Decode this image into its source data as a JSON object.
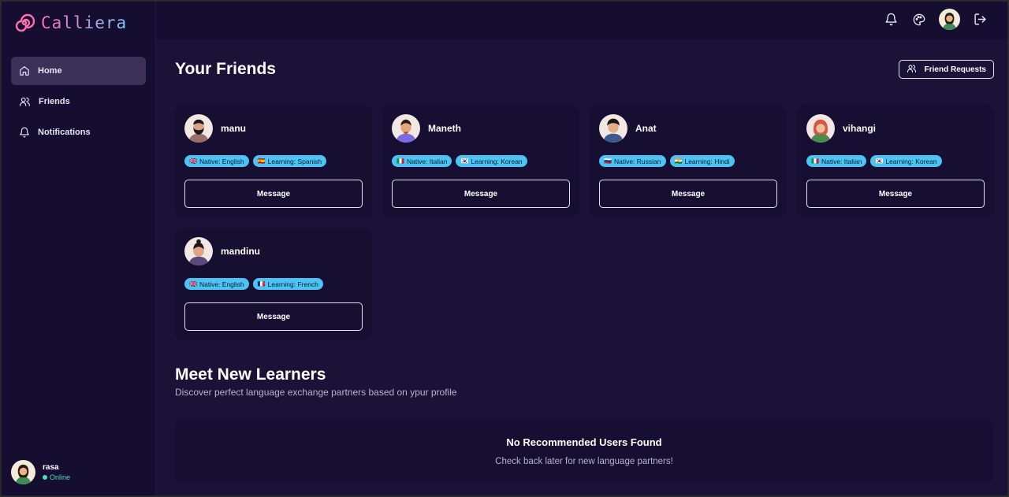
{
  "app": {
    "name": "Calliera"
  },
  "sidebar": {
    "items": [
      {
        "label": "Home",
        "icon": "home-icon",
        "active": true
      },
      {
        "label": "Friends",
        "icon": "users-icon",
        "active": false
      },
      {
        "label": "Notifications",
        "icon": "bell-icon",
        "active": false
      }
    ],
    "user": {
      "name": "rasa",
      "status": "Online"
    }
  },
  "header": {
    "icons": [
      "bell-icon",
      "palette-icon",
      "avatar",
      "logout-icon"
    ]
  },
  "friends_section": {
    "title": "Your Friends",
    "requests_label": "Friend Requests",
    "message_label": "Message",
    "friends": [
      {
        "name": "manu",
        "native": "Native: English",
        "native_flag": "🇬🇧",
        "learning": "Learning: Spanish",
        "learning_flag": "🇪🇸"
      },
      {
        "name": "Maneth",
        "native": "Native: Italian",
        "native_flag": "🇮🇹",
        "learning": "Learning: Korean",
        "learning_flag": "🇰🇷"
      },
      {
        "name": "Anat",
        "native": "Native: Russian",
        "native_flag": "🇷🇺",
        "learning": "Learning: Hindi",
        "learning_flag": "🇮🇳"
      },
      {
        "name": "vihangi",
        "native": "Native: Italian",
        "native_flag": "🇮🇹",
        "learning": "Learning: Korean",
        "learning_flag": "🇰🇷"
      },
      {
        "name": "mandinu",
        "native": "Native: English",
        "native_flag": "🇬🇧",
        "learning": "Learning: French",
        "learning_flag": "🇫🇷"
      }
    ]
  },
  "learners_section": {
    "title": "Meet New Learners",
    "subtitle": "Discover perfect language exchange partners based on ypur profile",
    "empty_title": "No Recommended Users Found",
    "empty_subtitle": "Check back later for new language partners!"
  },
  "colors": {
    "background": "#1b1238",
    "sidebar": "#160e30",
    "card": "#170f32",
    "badge": "#4cc3f5",
    "accent_pink": "#ff6fb0",
    "online": "#4fe0b8"
  }
}
